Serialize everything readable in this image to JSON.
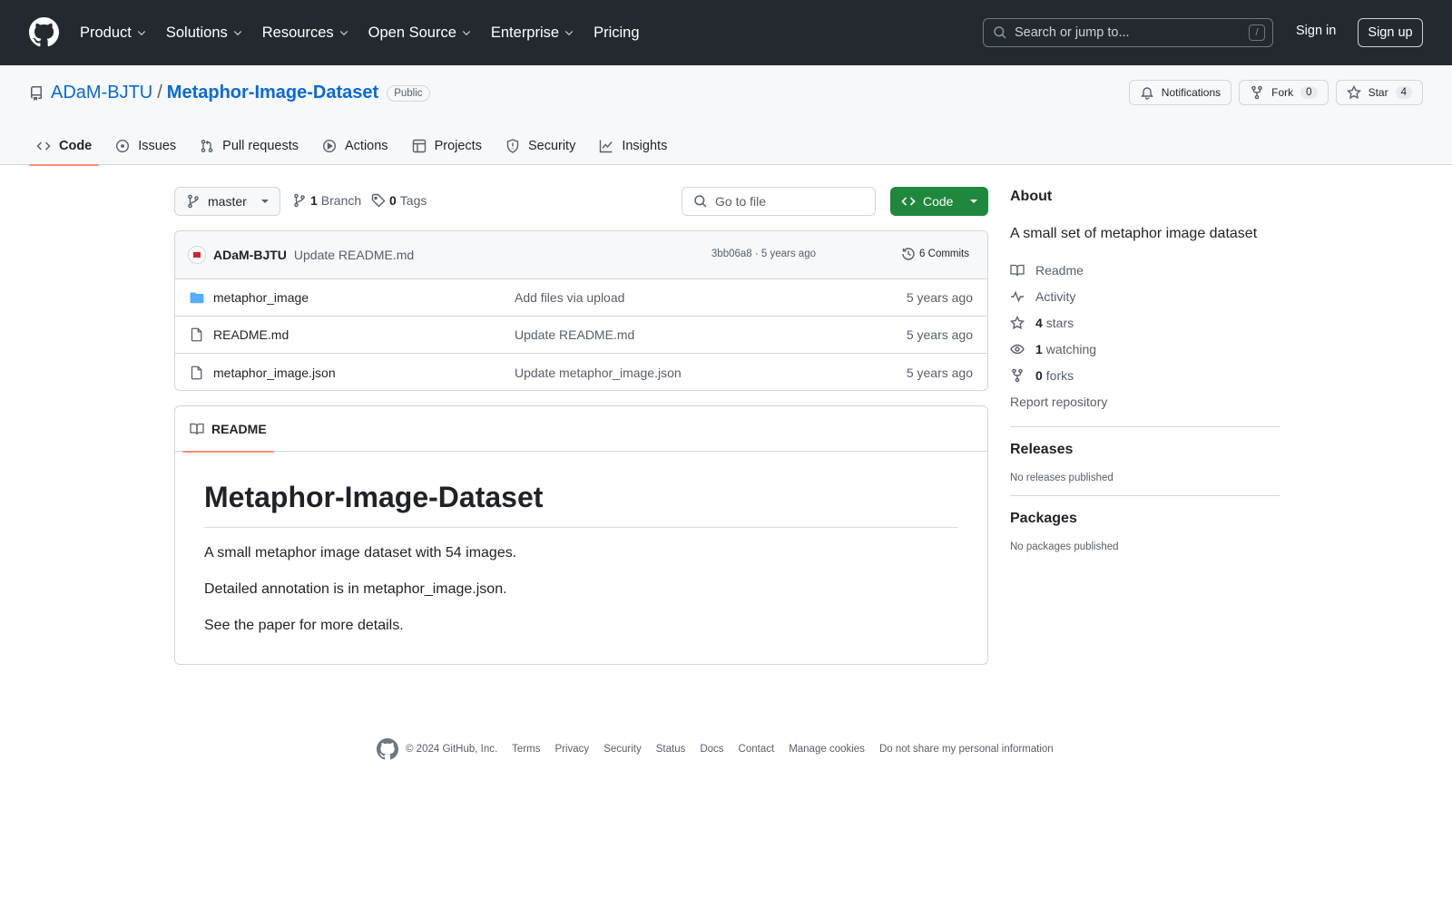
{
  "header": {
    "nav": [
      "Product",
      "Solutions",
      "Resources",
      "Open Source",
      "Enterprise",
      "Pricing"
    ],
    "search_placeholder": "Search or jump to...",
    "search_shortcut": "/",
    "sign_in": "Sign in",
    "sign_up": "Sign up"
  },
  "repo": {
    "owner": "ADaM-BJTU",
    "separator": "/",
    "name": "Metaphor-Image-Dataset",
    "visibility": "Public",
    "notifications_label": "Notifications",
    "fork_label": "Fork",
    "fork_count": "0",
    "star_label": "Star",
    "star_count": "4"
  },
  "tabs": [
    {
      "label": "Code",
      "icon": "code-icon"
    },
    {
      "label": "Issues",
      "icon": "issue-icon"
    },
    {
      "label": "Pull requests",
      "icon": "pull-request-icon"
    },
    {
      "label": "Actions",
      "icon": "play-icon"
    },
    {
      "label": "Projects",
      "icon": "table-icon"
    },
    {
      "label": "Security",
      "icon": "shield-icon"
    },
    {
      "label": "Insights",
      "icon": "graph-icon"
    }
  ],
  "toolbar": {
    "branch": "master",
    "branch_count": "1",
    "branch_label": "Branch",
    "tag_count": "0",
    "tag_label": "Tags",
    "goto_placeholder": "Go to file",
    "code_button": "Code"
  },
  "latest_commit": {
    "author": "ADaM-BJTU",
    "message": "Update README.md",
    "hash_time": "3bb06a8 · 5 years ago",
    "commits": "6 Commits"
  },
  "files": [
    {
      "name": "metaphor_image",
      "type": "dir",
      "message": "Add files via upload",
      "date": "5 years ago"
    },
    {
      "name": "README.md",
      "type": "file",
      "message": "Update README.md",
      "date": "5 years ago"
    },
    {
      "name": "metaphor_image.json",
      "type": "file",
      "message": "Update metaphor_image.json",
      "date": "5 years ago"
    }
  ],
  "readme": {
    "tab_label": "README",
    "title": "Metaphor-Image-Dataset",
    "paragraphs": [
      "A small metaphor image dataset with 54 images.",
      "Detailed annotation is in metaphor_image.json.",
      "See the paper for more details."
    ]
  },
  "sidebar": {
    "about_title": "About",
    "description": "A small set of metaphor image dataset",
    "readme": "Readme",
    "activity": "Activity",
    "stars_count": "4",
    "stars_label": "stars",
    "watching_count": "1",
    "watching_label": "watching",
    "forks_count": "0",
    "forks_label": "forks",
    "report": "Report repository",
    "releases_title": "Releases",
    "releases_empty": "No releases published",
    "packages_title": "Packages",
    "packages_empty": "No packages published"
  },
  "footer": {
    "copyright": "© 2024 GitHub, Inc.",
    "links": [
      "Terms",
      "Privacy",
      "Security",
      "Status",
      "Docs",
      "Contact",
      "Manage cookies",
      "Do not share my personal information"
    ]
  },
  "colors": {
    "header_bg": "#24292f",
    "link": "#0969da",
    "primary_button": "#1f883d",
    "tab_underline": "#fd8c73",
    "folder": "#54aeff"
  }
}
